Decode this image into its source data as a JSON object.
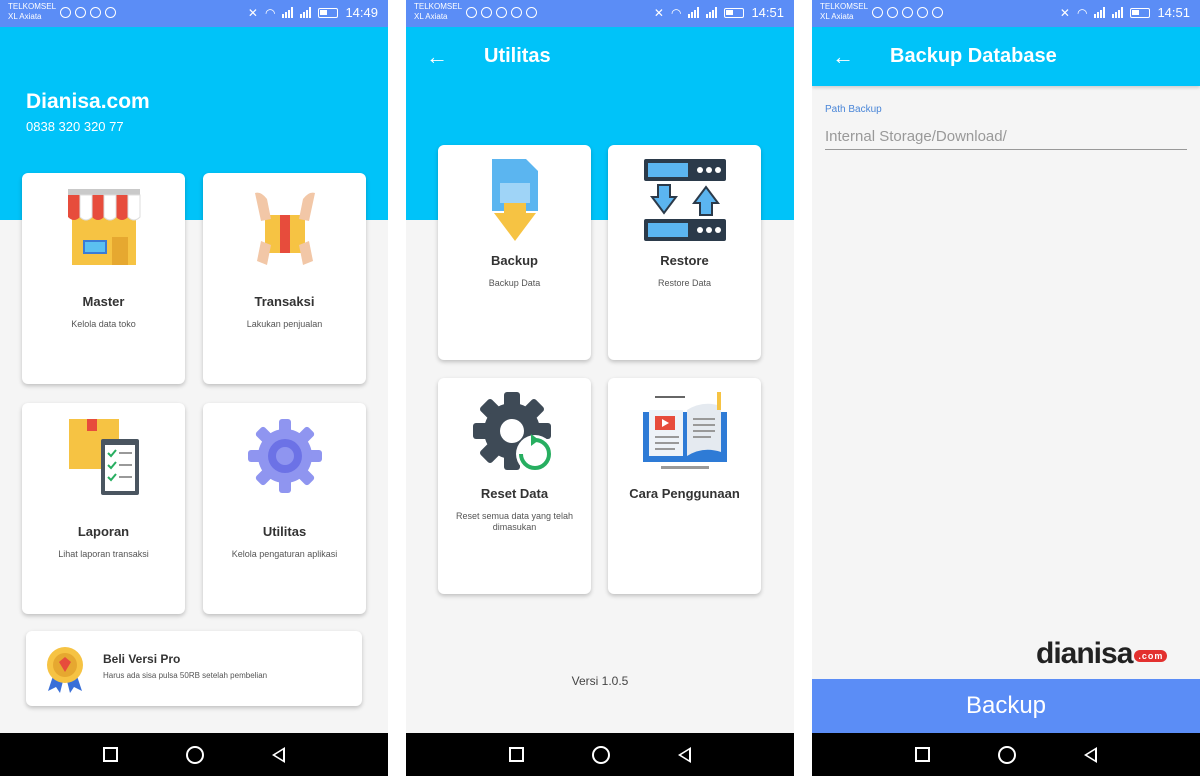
{
  "status_bar": {
    "carrier_1": "TELKOMSEL",
    "carrier_2": "XL Axiata",
    "times": [
      "14:49",
      "14:51",
      "14:51"
    ]
  },
  "screen_home": {
    "brand_name": "Dianisa.com",
    "phone": "0838 320 320 77",
    "cards": [
      {
        "title": "Master",
        "subtitle": "Kelola data toko",
        "icon": "store-icon"
      },
      {
        "title": "Transaksi",
        "subtitle": "Lakukan penjualan",
        "icon": "package-hands-icon"
      },
      {
        "title": "Laporan",
        "subtitle": "Lihat laporan transaksi",
        "icon": "report-clipboard-icon"
      },
      {
        "title": "Utilitas",
        "subtitle": "Kelola pengaturan aplikasi",
        "icon": "gear-icon"
      }
    ],
    "pro": {
      "title": "Beli Versi Pro",
      "subtitle": "Harus ada sisa pulsa 50RB setelah pembelian",
      "icon": "award-badge-icon"
    }
  },
  "screen_utilitas": {
    "title": "Utilitas",
    "cards": [
      {
        "title": "Backup",
        "subtitle": "Backup Data",
        "icon": "backup-icon"
      },
      {
        "title": "Restore",
        "subtitle": "Restore Data",
        "icon": "restore-servers-icon"
      },
      {
        "title": "Reset Data",
        "subtitle": "Reset semua data yang telah dimasukan",
        "icon": "reset-gear-icon"
      },
      {
        "title": "Cara Penggunaan",
        "subtitle": "",
        "icon": "guide-book-icon"
      }
    ],
    "version": "Versi 1.0.5"
  },
  "screen_backup": {
    "title": "Backup Database",
    "path_label": "Path Backup",
    "path_placeholder": "Internal Storage/Download/",
    "watermark": "dianisa",
    "watermark_suffix": ".com",
    "button_label": "Backup"
  },
  "colors": {
    "primary": "#00c3f9",
    "status_bar": "#5b8df6",
    "button": "#5b8df6",
    "watermark_accent": "#e3312f"
  }
}
